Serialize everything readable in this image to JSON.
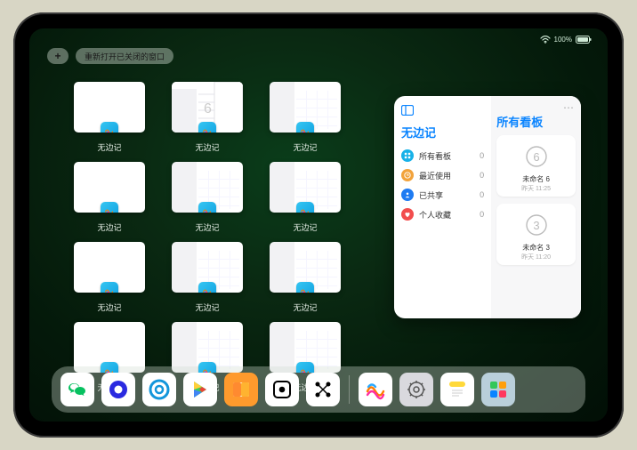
{
  "status": {
    "battery_text": "100%"
  },
  "top": {
    "plus_label": "+",
    "reopen_label": "重新打开已关闭的窗口"
  },
  "switcher": {
    "app_name": "无边记",
    "cards": [
      {
        "variant": "blank"
      },
      {
        "variant": "split"
      },
      {
        "variant": "board"
      },
      {
        "variant": "blank"
      },
      {
        "variant": "board"
      },
      {
        "variant": "board"
      },
      {
        "variant": "blank"
      },
      {
        "variant": "board"
      },
      {
        "variant": "board"
      },
      {
        "variant": "blank"
      },
      {
        "variant": "board"
      },
      {
        "variant": "board"
      }
    ]
  },
  "stage": {
    "left_title": "无边记",
    "right_title": "所有看板",
    "items": [
      {
        "label": "所有看板",
        "count": "0",
        "color": "#17b1e8",
        "icon": "grid"
      },
      {
        "label": "最近使用",
        "count": "0",
        "color": "#f2a33c",
        "icon": "clock"
      },
      {
        "label": "已共享",
        "count": "0",
        "color": "#1e7bf2",
        "icon": "people"
      },
      {
        "label": "个人收藏",
        "count": "0",
        "color": "#f24d4d",
        "icon": "heart"
      }
    ],
    "boards": [
      {
        "name": "未命名 6",
        "time": "昨天 11:25",
        "glyph": "6"
      },
      {
        "name": "未命名 3",
        "time": "昨天 11:20",
        "glyph": "3"
      }
    ]
  },
  "dock": {
    "icons": [
      {
        "name": "wechat",
        "bg": "#ffffff"
      },
      {
        "name": "quark",
        "bg": "#ffffff"
      },
      {
        "name": "qqbrowser",
        "bg": "#ffffff"
      },
      {
        "name": "play",
        "bg": "#ffffff"
      },
      {
        "name": "books",
        "bg": "#ff9a2d"
      },
      {
        "name": "dice",
        "bg": "#ffffff"
      },
      {
        "name": "nodes",
        "bg": "#ffffff"
      },
      {
        "name": "sep"
      },
      {
        "name": "freeform",
        "bg": "#ffffff"
      },
      {
        "name": "settings",
        "bg": "#d9d9de"
      },
      {
        "name": "notes",
        "bg": "#ffffff"
      },
      {
        "name": "appgroup",
        "bg": "#b9cfda"
      }
    ]
  }
}
